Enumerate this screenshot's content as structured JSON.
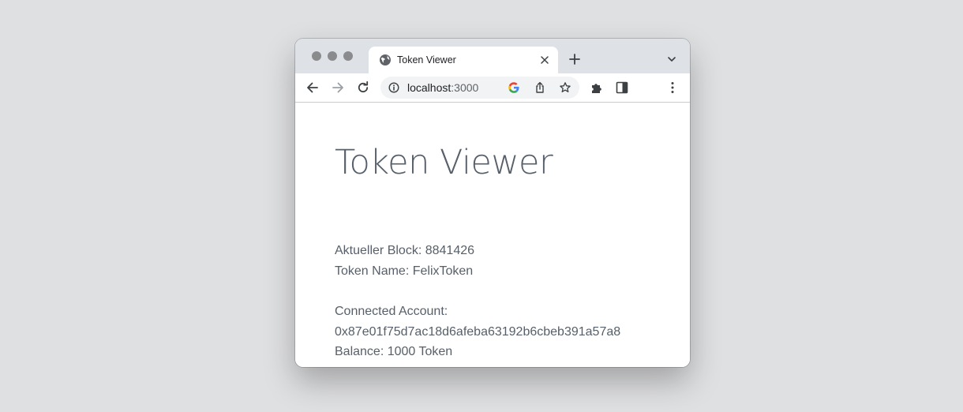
{
  "browser": {
    "tab_title": "Token Viewer",
    "url_host": "localhost",
    "url_port": ":3000"
  },
  "page": {
    "title": "Token Viewer",
    "block_label": "Aktueller Block:",
    "block_number": "8841426",
    "token_name_label": "Token Name:",
    "token_name": "FelixToken",
    "account_label": "Connected Account:",
    "account_address": "0x87e01f75d7ac18d6afeba63192b6cbeb391a57a8",
    "balance_label": "Balance:",
    "balance_value": "1000",
    "balance_unit": "Token"
  },
  "icons": {
    "favicon": "globe-icon",
    "close": "close-icon",
    "new_tab": "plus-icon",
    "tab_search": "chevron-down-icon",
    "back": "arrow-left-icon",
    "forward": "arrow-right-icon",
    "reload": "reload-icon",
    "site_info": "info-icon",
    "google": "google-icon",
    "share": "share-icon",
    "bookmark": "star-icon",
    "extensions": "puzzle-icon",
    "side_panel": "side-panel-icon",
    "menu": "kebab-menu-icon"
  },
  "colors": {
    "text": "#57606a",
    "chrome_frame": "#dee1e6",
    "background": "#dfe0e2"
  }
}
